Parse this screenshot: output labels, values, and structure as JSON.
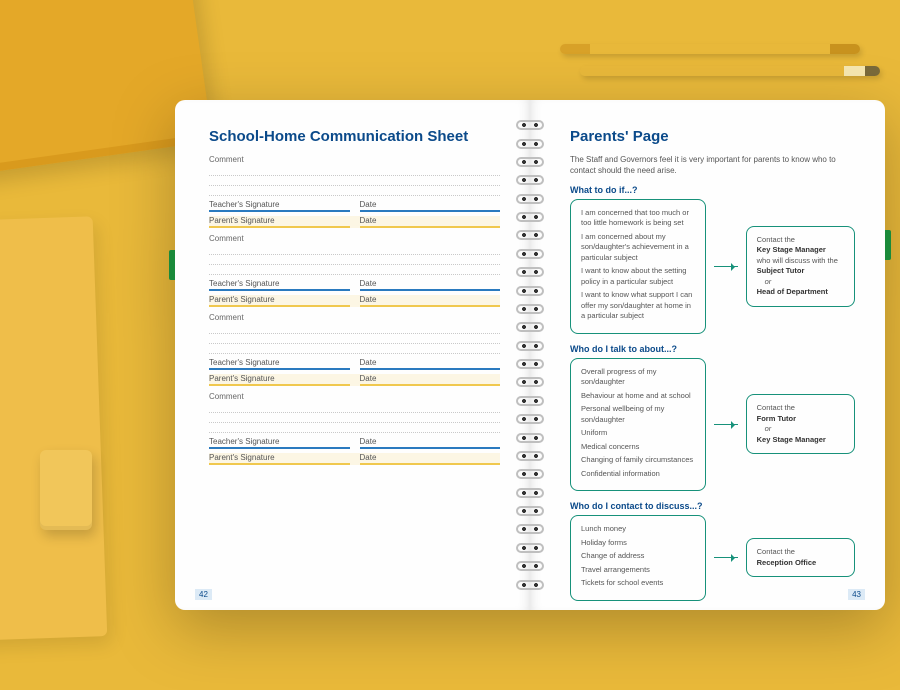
{
  "left": {
    "title": "School-Home Communication Sheet",
    "comment_label": "Comment",
    "teacher_sig": "Teacher's Signature",
    "parent_sig": "Parent's Signature",
    "date_label": "Date",
    "page_number": "42"
  },
  "right": {
    "title": "Parents' Page",
    "intro": "The Staff and Governors feel it is very important for parents to know who to contact should the need arise.",
    "sections": [
      {
        "heading": "What to do if...?",
        "concerns": [
          "I am concerned that too much or too little homework is being set",
          "I am concerned about my son/daughter's achievement in a particular subject",
          "I want to know about the setting policy in a particular subject",
          "I want to know what support I can offer my son/daughter at home in a particular subject"
        ],
        "contact_lead": "Contact the",
        "contacts": [
          "Key Stage Manager"
        ],
        "mid": "who will discuss with the",
        "contacts2": [
          "Subject Tutor",
          "Head of Department"
        ],
        "or": "or"
      },
      {
        "heading": "Who do I talk to about...?",
        "concerns": [
          "Overall progress of my son/daughter",
          "Behaviour at home and at school",
          "Personal wellbeing of my son/daughter",
          "Uniform",
          "Medical concerns",
          "Changing of family circumstances",
          "Confidential information"
        ],
        "contact_lead": "Contact the",
        "contacts": [
          "Form Tutor",
          "Key Stage Manager"
        ],
        "or": "or"
      },
      {
        "heading": "Who do I contact to discuss...?",
        "concerns": [
          "Lunch money",
          "Holiday forms",
          "Change of address",
          "Travel arrangements",
          "Tickets for school events"
        ],
        "contact_lead": "Contact the",
        "contacts": [
          "Reception Office"
        ]
      }
    ],
    "page_number": "43"
  }
}
